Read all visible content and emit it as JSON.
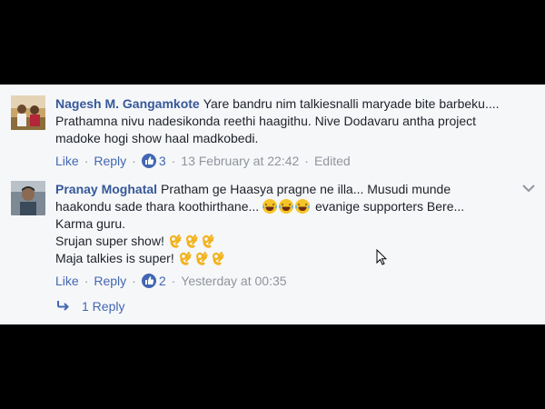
{
  "comments": [
    {
      "author": "Nagesh M. Gangamkote",
      "text_lines": [
        "Yare bandru nim talkiesnalli maryade bite barbeku....",
        "Prathamna nivu nadesikonda reethi haagithu. Nive Dodavaru antha project",
        "madoke hogi show haal madkobedi."
      ],
      "like_label": "Like",
      "reply_label": "Reply",
      "like_count": "3",
      "timestamp": "13 February at 22:42",
      "edited_label": "Edited"
    },
    {
      "author": "Pranay Moghatal",
      "text_line1": "Pratham ge Haasya pragne ne illa... Musudi munde",
      "text_line2_pre": "haakondu sade thara koothirthane...",
      "text_line2_post": "evanige supporters Bere...",
      "text_line3": "Karma guru.",
      "text_line4": "Srujan super show!",
      "text_line5": "Maja talkies is super!",
      "like_label": "Like",
      "reply_label": "Reply",
      "like_count": "2",
      "timestamp": "Yesterday at 00:35"
    }
  ],
  "replies_link": "1 Reply",
  "colors": {
    "link": "#4267b2",
    "author": "#365899",
    "panel_bg": "#f6f7f9",
    "muted": "#90949c"
  },
  "icons": [
    "like-thumb-icon",
    "laughing-emoji-icon",
    "ok-hand-emoji-icon",
    "chevron-down-icon",
    "reply-arrow-icon",
    "mouse-cursor-icon"
  ]
}
